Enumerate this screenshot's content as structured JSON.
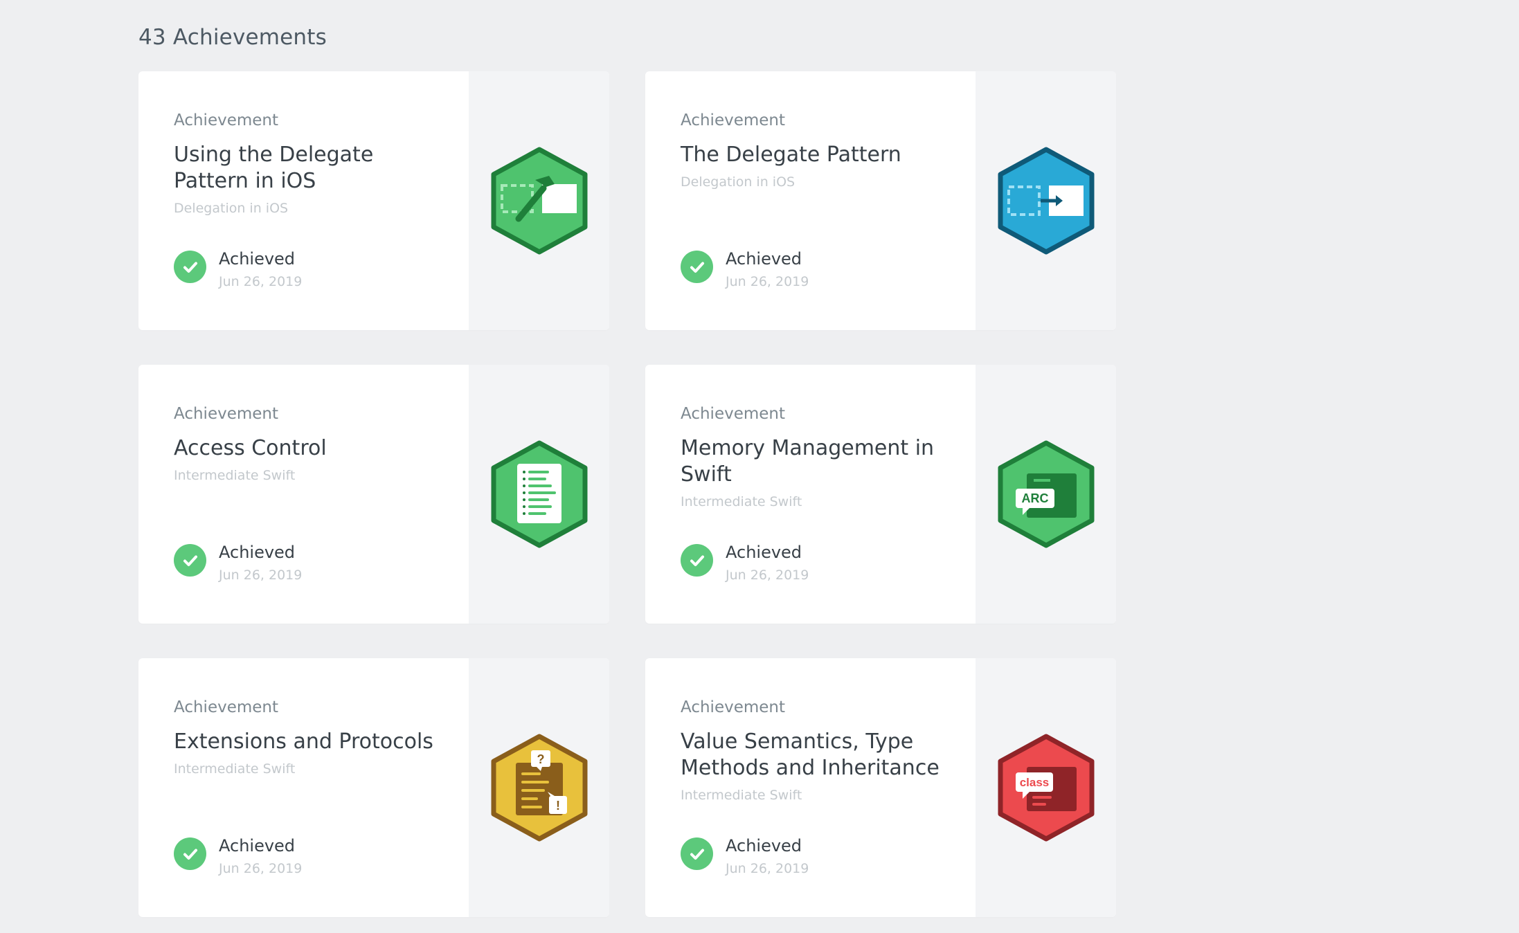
{
  "header": {
    "count_title": "43 Achievements"
  },
  "cards": [
    {
      "kind": "Achievement",
      "title": "Using the Delegate Pattern in iOS",
      "course": "Delegation in iOS",
      "status": "Achieved",
      "date": "Jun 26, 2019",
      "badge_icon": "delegate-hammer-icon",
      "badge_color": "#4fc36e"
    },
    {
      "kind": "Achievement",
      "title": "The Delegate Pattern",
      "course": "Delegation in iOS",
      "status": "Achieved",
      "date": "Jun 26, 2019",
      "badge_icon": "delegate-arrow-icon",
      "badge_color": "#29a9d6"
    },
    {
      "kind": "Achievement",
      "title": "Access Control",
      "course": "Intermediate Swift",
      "status": "Achieved",
      "date": "Jun 26, 2019",
      "badge_icon": "document-list-icon",
      "badge_color": "#4fc36e"
    },
    {
      "kind": "Achievement",
      "title": "Memory Management in Swift",
      "course": "Intermediate Swift",
      "status": "Achieved",
      "date": "Jun 26, 2019",
      "badge_icon": "arc-icon",
      "badge_color": "#4fc36e",
      "badge_text": "ARC"
    },
    {
      "kind": "Achievement",
      "title": "Extensions and Protocols",
      "course": "Intermediate Swift",
      "status": "Achieved",
      "date": "Jun 26, 2019",
      "badge_icon": "question-exclamation-icon",
      "badge_color": "#e8c13c",
      "badge_marks": [
        "?",
        "!"
      ]
    },
    {
      "kind": "Achievement",
      "title": "Value Semantics, Type Methods and Inheritance",
      "course": "Intermediate Swift",
      "status": "Achieved",
      "date": "Jun 26, 2019",
      "badge_icon": "class-icon",
      "badge_color": "#ec4a4e",
      "badge_text": "class"
    }
  ]
}
